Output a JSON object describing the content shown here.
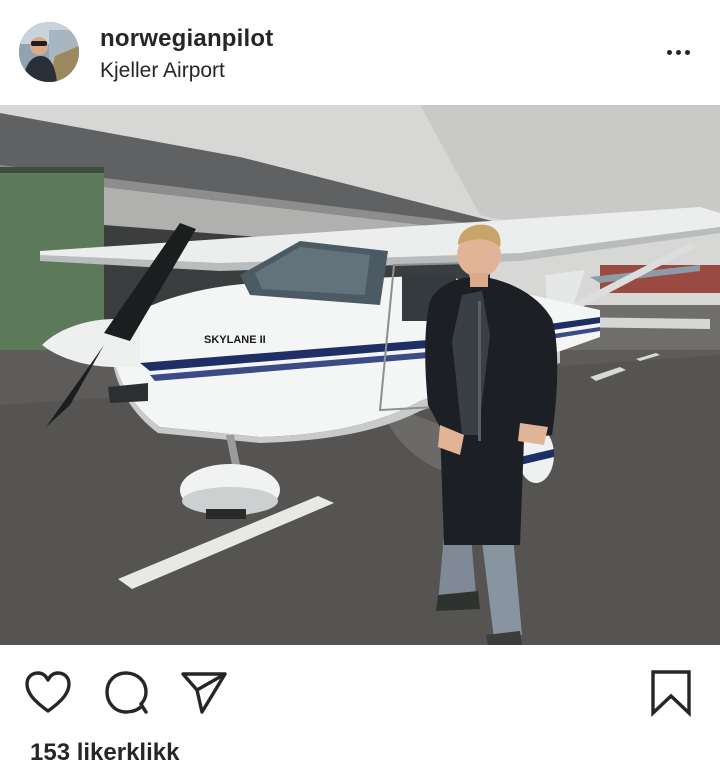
{
  "post": {
    "username": "norwegianpilot",
    "location": "Kjeller Airport",
    "likes_text": "153 likerklikk",
    "aircraft_marking": "SKYLANE II"
  },
  "icons": {
    "more": "more-options-icon",
    "like": "heart-icon",
    "comment": "comment-icon",
    "share": "send-icon",
    "save": "bookmark-icon"
  },
  "colors": {
    "text": "#262626",
    "background": "#ffffff",
    "aircraft_stripe": "#1f2f66"
  }
}
